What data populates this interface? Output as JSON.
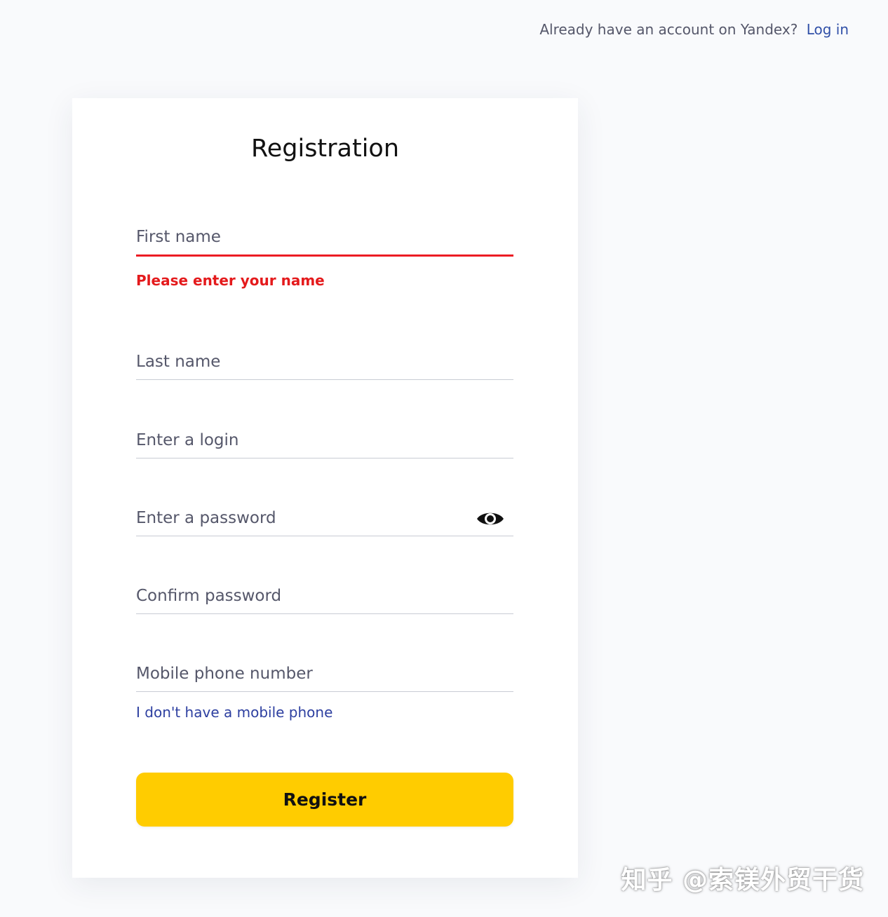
{
  "header": {
    "prompt": "Already have an account on Yandex?",
    "login_link": "Log in"
  },
  "form": {
    "title": "Registration",
    "fields": {
      "first_name": {
        "placeholder": "First name",
        "value": "",
        "error": "Please enter your name"
      },
      "last_name": {
        "placeholder": "Last name",
        "value": ""
      },
      "login": {
        "placeholder": "Enter a login",
        "value": ""
      },
      "password": {
        "placeholder": "Enter a password",
        "value": ""
      },
      "confirm_password": {
        "placeholder": "Confirm password",
        "value": ""
      },
      "phone": {
        "placeholder": "Mobile phone number",
        "value": ""
      }
    },
    "no_phone_link": "I don't have a mobile phone",
    "register_label": "Register",
    "colors": {
      "error": "#ec1c24",
      "button": "#ffcc00",
      "link": "#2d3fa0"
    },
    "icons": {
      "password_toggle": "eye-icon"
    }
  },
  "watermark": "知乎 @索镁外贸干货"
}
